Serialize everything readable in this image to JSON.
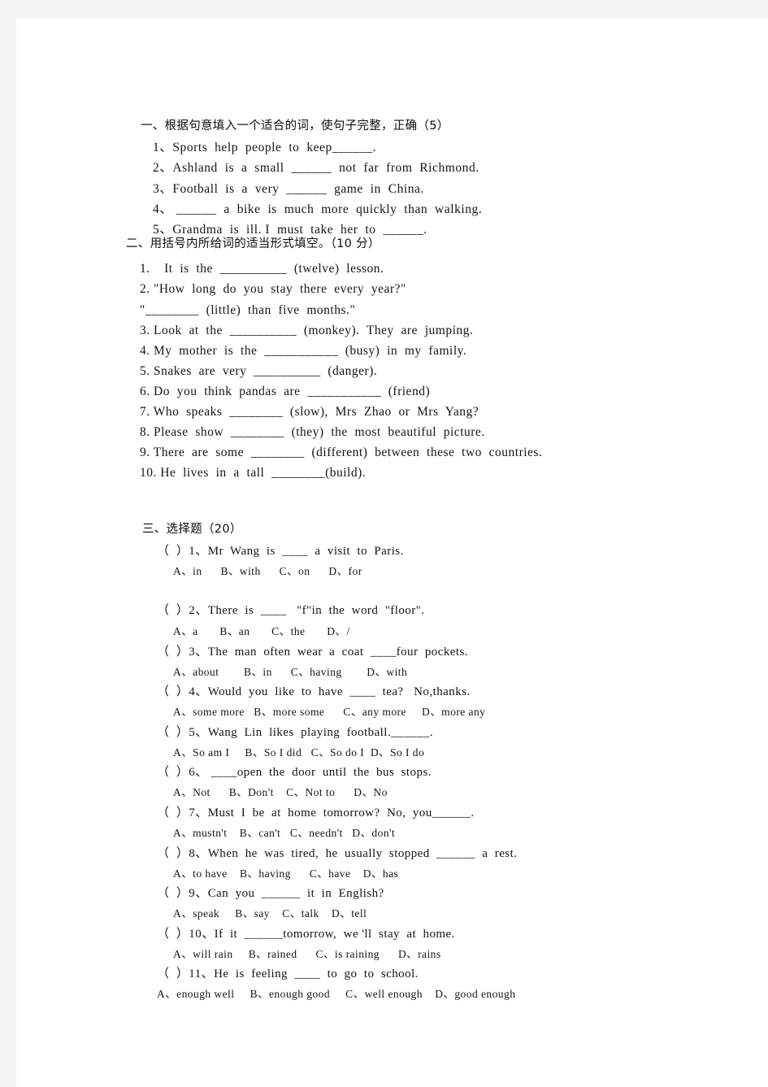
{
  "document": {
    "page_bg": "#ffffff",
    "canvas_bg": "#f4f4f4",
    "text_color": "#141414"
  },
  "section1": {
    "heading": "一、根据句意填入一个适合的词，使句子完整，正确（5）",
    "items": [
      "1、Sports  help  people  to  keep______.",
      "2、Ashland  is  a  small  ______  not  far  from  Richmond.",
      "3、Football  is  a  very  ______  game  in  China.",
      "4、 ______  a  bike  is  much  more  quickly  than  walking.",
      "5、Grandma  is  ill. I  must  take  her  to  ______."
    ]
  },
  "section2": {
    "heading": "二、用括号内所给词的适当形式填空。（10 分）",
    "items": [
      "1.    It  is  the  __________  (twelve)  lesson.",
      "2. \"How  long  do  you  stay  there  every  year?\"",
      "\"________  (little)  than  five  months.\"",
      "3. Look  at  the  __________  (monkey).  They  are  jumping.",
      "4. My  mother  is  the  ___________  (busy)  in  my  family.",
      "5. Snakes  are  very  __________  (danger).",
      "6. Do  you  think  pandas  are  ___________  (friend)",
      "7. Who  speaks  ________  (slow),  Mrs  Zhao  or  Mrs  Yang?",
      "8. Please  show  ________  (they)  the  most  beautiful  picture.",
      "9. There  are  some  ________  (different)  between  these  two  countries.",
      "10. He  lives  in  a  tall  ________(build)."
    ]
  },
  "section3": {
    "heading": "三、选择题（20）",
    "questions": [
      {
        "stem": "（  ）1、Mr  Wang  is  ____  a  visit  to  Paris.",
        "options": "A、in      B、with      C、on      D、for"
      },
      {
        "stem": "（  ）2、There  is  ____   \"f\"in  the  word  \"floor\".",
        "options": "A、a       B、an       C、the       D、/"
      },
      {
        "stem": "（  ）3、The  man  often  wear  a  coat  ____four  pockets.",
        "options": "A、about        B、in      C、having        D、with"
      },
      {
        "stem": "（  ）4、Would  you  like  to  have  ____  tea?   No,thanks.",
        "options": "A、some more   B、more some      C、any more     D、more any"
      },
      {
        "stem": "（  ）5、Wang  Lin  likes  playing  football.______.",
        "options": "A、So am I     B、So I did   C、So do I  D、So I do"
      },
      {
        "stem": "（  ）6、 ____open  the  door  until  the  bus  stops.",
        "options": "A、Not      B、Don't    C、Not to      D、No"
      },
      {
        "stem": "（  ）7、Must  I  be  at  home  tomorrow?  No,  you______.",
        "options": "A、mustn't    B、can't   C、needn't   D、don't"
      },
      {
        "stem": "（  ）8、When  he  was  tired,  he  usually  stopped  ______  a  rest.",
        "options": "A、to have    B、having      C、have    D、has"
      },
      {
        "stem": "（  ）9、Can  you  ______  it  in  English?",
        "options": "A、speak     B、say    C、talk    D、tell"
      },
      {
        "stem": "（  ）10、If  it  ______tomorrow,  we 'll  stay  at  home.",
        "options": "A、will rain     B、rained      C、is raining      D、rains"
      },
      {
        "stem": "（  ）11、He  is  feeling  ____  to  go  to  school.",
        "options": "A、enough well     B、enough good     C、well enough    D、good enough"
      }
    ]
  }
}
